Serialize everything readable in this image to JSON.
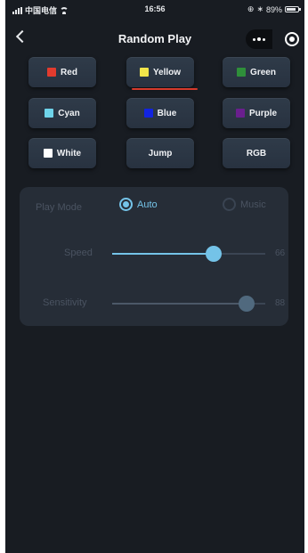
{
  "status_bar": {
    "carrier": "中国电信",
    "time": "16:56",
    "battery_text": "89%",
    "battery_level": 0.89
  },
  "header": {
    "title": "Random Play",
    "back_icon": "chevron-left-icon",
    "more_icon": "more-dots-icon",
    "close_icon": "target-circle-icon"
  },
  "color_buttons": [
    {
      "label": "Red",
      "swatch": "#e23b2e"
    },
    {
      "label": "Yellow",
      "swatch": "#f2e54a",
      "selected": true
    },
    {
      "label": "Green",
      "swatch": "#2f8f3a"
    },
    {
      "label": "Cyan",
      "swatch": "#6fd4ea"
    },
    {
      "label": "Blue",
      "swatch": "#1224e0"
    },
    {
      "label": "Purple",
      "swatch": "#6a1f8e"
    },
    {
      "label": "White",
      "swatch": "#ffffff"
    },
    {
      "label": "Jump"
    },
    {
      "label": "RGB"
    }
  ],
  "play_mode": {
    "label": "Play Mode",
    "options": [
      {
        "label": "Auto",
        "selected": true
      },
      {
        "label": "Music",
        "selected": false
      }
    ]
  },
  "speed": {
    "label": "Speed",
    "value": "66",
    "level": 0.66,
    "enabled": true
  },
  "sensitivity": {
    "label": "Sensitivity",
    "value": "88",
    "level": 0.88,
    "enabled": false
  },
  "colors": {
    "background": "#181c22",
    "panel": "#262d37",
    "accent": "#74c3e8",
    "selected_underline": "#d63a2c"
  }
}
